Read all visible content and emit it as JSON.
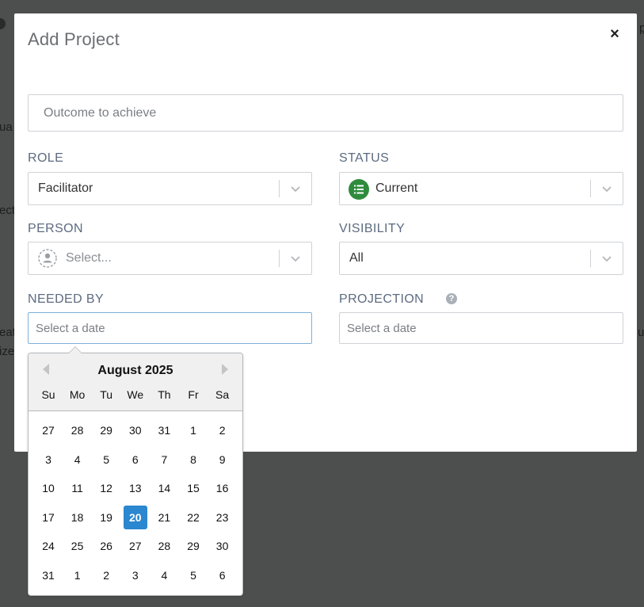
{
  "modal": {
    "title": "Add Project",
    "close_label": "×"
  },
  "outcome": {
    "placeholder": "Outcome to achieve"
  },
  "role": {
    "label": "ROLE",
    "value": "Facilitator"
  },
  "status": {
    "label": "STATUS",
    "value": "Current",
    "icon": "list-icon",
    "icon_color": "#2e8b3c"
  },
  "person": {
    "label": "PERSON",
    "placeholder": "Select...",
    "icon": "person-placeholder-icon"
  },
  "visibility": {
    "label": "VISIBILITY",
    "value": "All"
  },
  "needed_by": {
    "label": "NEEDED BY",
    "placeholder": "Select a date"
  },
  "projection": {
    "label": "PROJECTION",
    "placeholder": "Select a date",
    "help": "?"
  },
  "datepicker": {
    "month_label": "August 2025",
    "weekdays": [
      "Su",
      "Mo",
      "Tu",
      "We",
      "Th",
      "Fr",
      "Sa"
    ],
    "weeks": [
      [
        "27",
        "28",
        "29",
        "30",
        "31",
        "1",
        "2"
      ],
      [
        "3",
        "4",
        "5",
        "6",
        "7",
        "8",
        "9"
      ],
      [
        "10",
        "11",
        "12",
        "13",
        "14",
        "15",
        "16"
      ],
      [
        "17",
        "18",
        "19",
        "20",
        "21",
        "22",
        "23"
      ],
      [
        "24",
        "25",
        "26",
        "27",
        "28",
        "29",
        "30"
      ],
      [
        "31",
        "1",
        "2",
        "3",
        "4",
        "5",
        "6"
      ]
    ],
    "selected": "20",
    "accent": "#2a87d0"
  },
  "background": {
    "fragments": [
      "ua",
      "ect",
      "eat",
      "ize",
      "u",
      "p"
    ]
  }
}
